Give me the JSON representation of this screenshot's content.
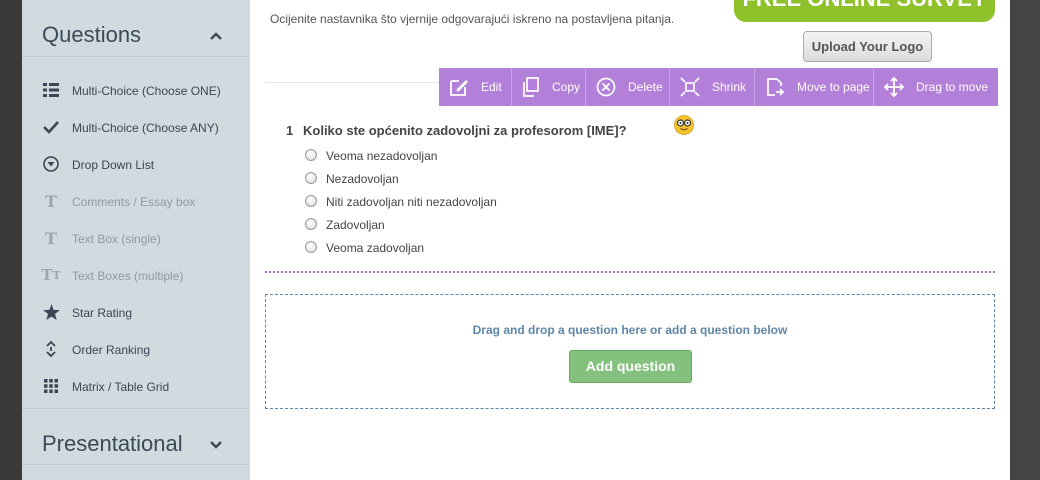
{
  "sidebar": {
    "questions_title": "Questions",
    "presentational_title": "Presentational",
    "items": [
      {
        "label": "Multi-Choice (Choose ONE)",
        "icon": "list-icon"
      },
      {
        "label": "Multi-Choice (Choose ANY)",
        "icon": "checkmark-icon"
      },
      {
        "label": "Drop Down List",
        "icon": "dropdown-circle-icon"
      },
      {
        "label": "Comments / Essay box",
        "icon": "text-t-icon"
      },
      {
        "label": "Text Box (single)",
        "icon": "text-t-icon"
      },
      {
        "label": "Text Boxes (multiple)",
        "icon": "text-tt-icon"
      },
      {
        "label": "Star Rating",
        "icon": "star-icon"
      },
      {
        "label": "Order Ranking",
        "icon": "sort-arrows-icon"
      },
      {
        "label": "Matrix / Table Grid",
        "icon": "grid-icon"
      }
    ]
  },
  "header": {
    "description": "Ocijenite nastavnika što vjernije odgovarajući iskreno na postavljena pitanja.",
    "banner_text": "FREE ONLINE SURVEY",
    "upload_logo": "Upload Your Logo"
  },
  "toolbar": {
    "edit": "Edit",
    "copy": "Copy",
    "delete": "Delete",
    "shrink": "Shrink",
    "move_to_page": "Move to page",
    "drag_to_move": "Drag to move"
  },
  "question": {
    "number": "1",
    "text": "Koliko ste općenito zadovoljni za profesorom [IME]?",
    "options": [
      "Veoma nezadovoljan",
      "Nezadovoljan",
      "Niti zadovoljan niti nezadovoljan",
      "Zadovoljan",
      "Veoma zadovoljan"
    ]
  },
  "dropzone": {
    "text": "Drag and drop a question here or add a question below",
    "add_button": "Add question"
  },
  "colors": {
    "toolbar": "#b27fd9",
    "sidebar": "#d0dadf",
    "add_button": "#84c17e",
    "banner": "#8fc12b"
  }
}
